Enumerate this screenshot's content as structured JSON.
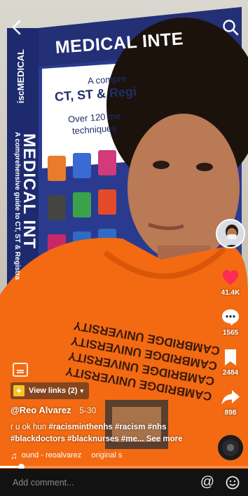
{
  "book": {
    "title": "MEDICAL INTE",
    "subtitle_line1": "A compre",
    "subtitle_line2": "CT, ST & Regi",
    "subtitle_line3": "Over 120 me",
    "subtitle_line4": "techniques",
    "spine_brand": "iscMEDICAL",
    "spine_title": "MEDICAL INT",
    "spine_subtitle": "A comprehensive guide to CT, ST & Registra"
  },
  "hoodie_text": "CAMBRIDGE UNIVERSITY",
  "actions": {
    "likes": "41.4K",
    "comments": "1565",
    "saves": "2484",
    "shares": "898"
  },
  "links_pill": {
    "label": "View links (2)"
  },
  "post": {
    "author": "@Reo Alvarez",
    "date": "5-30",
    "description_lead": "r u ok hun",
    "hashtags_line1": "#racisminthenhs #racism #nhs",
    "hashtags_line2": "#blackdoctors #blacknurses #me...",
    "see_more": "See more"
  },
  "music": {
    "sound": "ound - reoalvarez",
    "original": "original s"
  },
  "playback": {
    "progress": 0.085
  },
  "comment_bar": {
    "placeholder": "Add comment..."
  },
  "colors": {
    "like_red": "#fe2c55",
    "hoodie_orange": "#f36a12",
    "book_blue": "#1f2d6b",
    "links_star": "#f6c324"
  }
}
